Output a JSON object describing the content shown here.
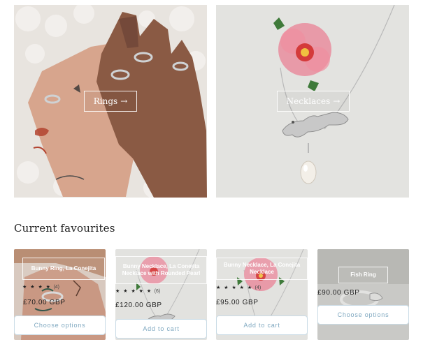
{
  "categories": [
    {
      "label": "Rings",
      "arrow": "→"
    },
    {
      "label": "Necklaces",
      "arrow": "→"
    }
  ],
  "section": {
    "heading": "Current favourites"
  },
  "products": [
    {
      "title": "Bunny Ring, La Conejita",
      "stars": "★ ★ ★ ★",
      "rating_count": "(4)",
      "price": "£70.00 GBP",
      "cta": "Choose options"
    },
    {
      "title": "Bunny Necklace, La Conejita Necklace with Rounded Pearl",
      "stars": "★ ★ ★ ★ ★",
      "rating_count": "(6)",
      "price": "£120.00 GBP",
      "cta": "Add to cart"
    },
    {
      "title": "Bunny Necklace, La Conejita Necklace",
      "stars": "★ ★ ★ ★ ★",
      "rating_count": "(4)",
      "price": "£95.00 GBP",
      "cta": "Add to cart"
    },
    {
      "title": "Fish Ring",
      "stars": "",
      "rating_count": "",
      "price": "£90.00 GBP",
      "cta": "Choose options"
    }
  ],
  "colors": {
    "button_border": "#c9dbe6",
    "button_text": "#7fa8c0",
    "flower_pink": "#e89aa8"
  },
  "icons": {
    "arrow": "arrow-right-icon",
    "star": "star-icon"
  }
}
